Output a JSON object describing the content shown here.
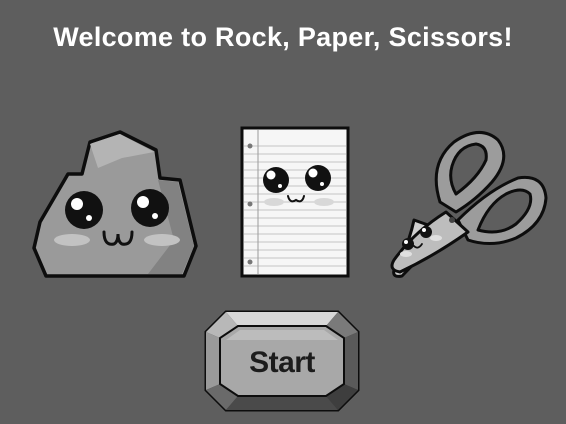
{
  "title": "Welcome to Rock, Paper, Scissors!",
  "choices": [
    {
      "name": "rock",
      "icon": "rock-character-icon"
    },
    {
      "name": "paper",
      "icon": "paper-character-icon"
    },
    {
      "name": "scissors",
      "icon": "scissors-character-icon"
    }
  ],
  "start_button": {
    "label": "Start"
  },
  "colors": {
    "background": "#5e5e5e",
    "title": "#ffffff",
    "outline": "#111111"
  }
}
